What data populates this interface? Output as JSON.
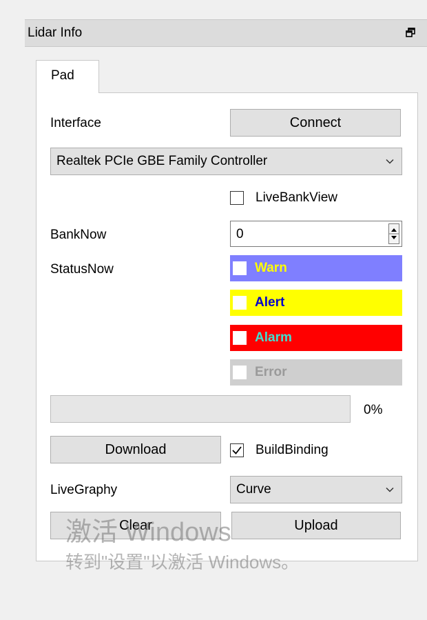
{
  "window": {
    "title": "Lidar Info",
    "float_icon": "float-window-icon",
    "close_glyph": "✕"
  },
  "tabs": [
    {
      "label": "Pad"
    }
  ],
  "interface": {
    "label": "Interface",
    "connect_label": "Connect",
    "adapter_selected": "Realtek PCIe GBE Family Controller"
  },
  "live_bank_view": {
    "label": "LiveBankView",
    "checked": false
  },
  "bank_now": {
    "label": "BankNow",
    "value": "0"
  },
  "status_now": {
    "label": "StatusNow",
    "items": [
      {
        "label": "Warn",
        "bg": "#7f7fff",
        "fg": "#ffff00"
      },
      {
        "label": "Alert",
        "bg": "#ffff00",
        "fg": "#0000cc"
      },
      {
        "label": "Alarm",
        "bg": "#ff0000",
        "fg": "#40e0d0"
      },
      {
        "label": "Error",
        "bg": "#cfcfcf",
        "fg": "#9a9a9a"
      }
    ]
  },
  "progress": {
    "value": 0,
    "text": "0%"
  },
  "download": {
    "label": "Download"
  },
  "build_binding": {
    "label": "BuildBinding",
    "checked": true
  },
  "live_graphy": {
    "label": "LiveGraphy",
    "selected": "Curve"
  },
  "actions": {
    "clear_label": "Clear",
    "upload_label": "Upload"
  },
  "watermark": {
    "line1": "激活 Windows",
    "line2": "转到\"设置\"以激活 Windows。"
  }
}
